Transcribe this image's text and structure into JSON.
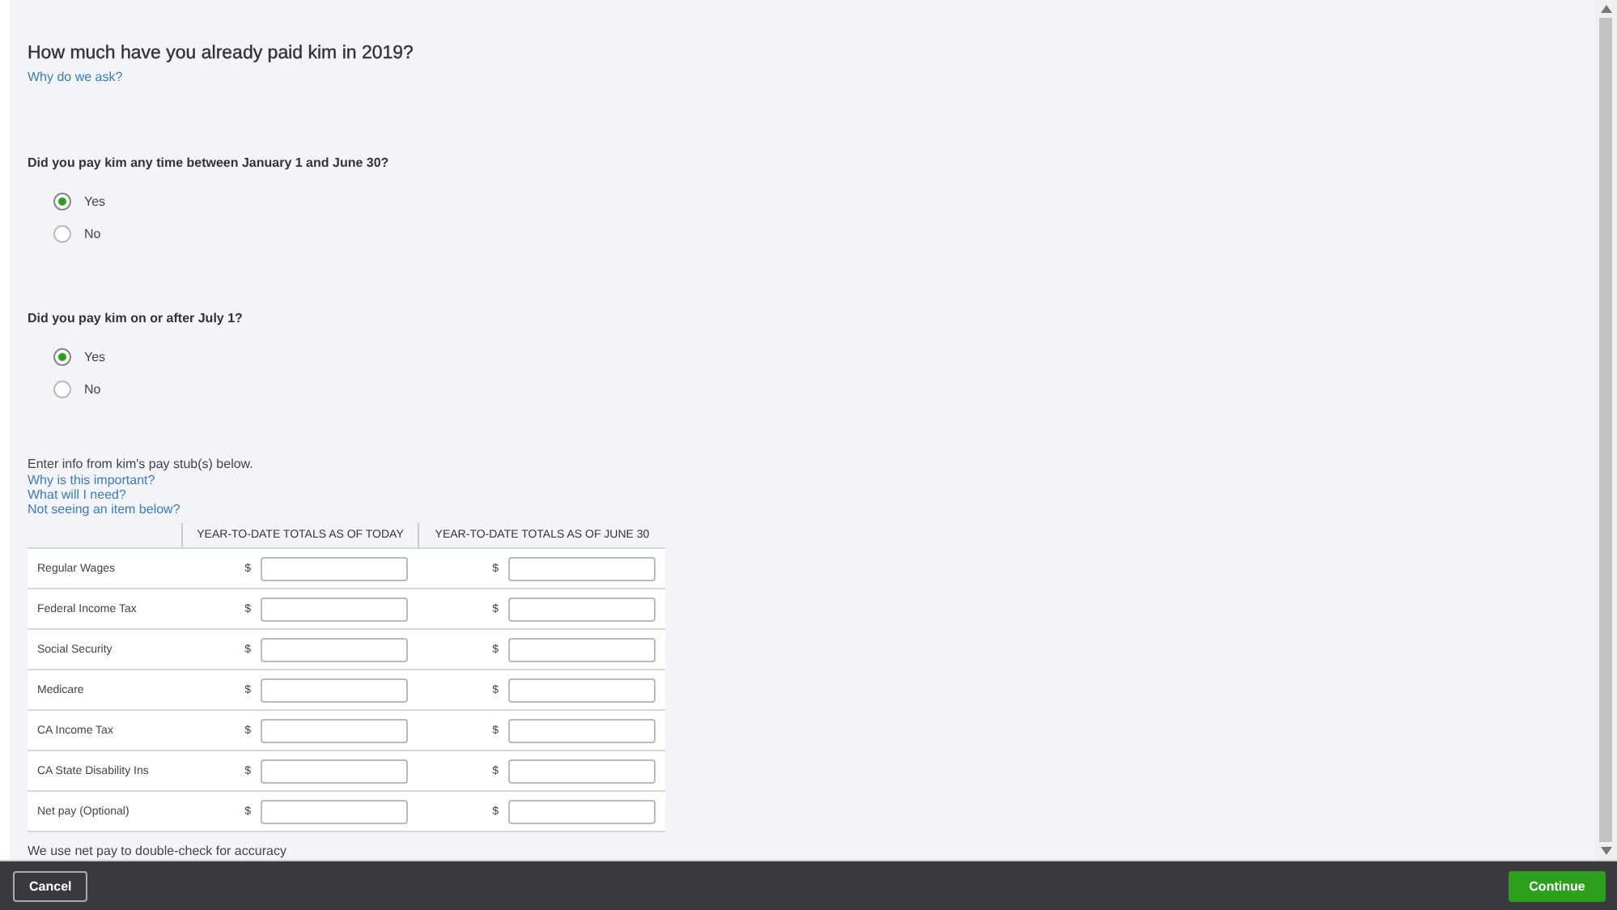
{
  "title": "How much have you already paid kim in 2019?",
  "title_link": "Why do we ask?",
  "questions": [
    {
      "label": "Did you pay kim any time between January 1 and June 30?",
      "options": [
        {
          "label": "Yes",
          "selected": true
        },
        {
          "label": "No",
          "selected": false
        }
      ]
    },
    {
      "label": "Did you pay kim on or after July 1?",
      "options": [
        {
          "label": "Yes",
          "selected": true
        },
        {
          "label": "No",
          "selected": false
        }
      ]
    }
  ],
  "stub_intro": "Enter info from kim's pay stub(s) below.",
  "help_links": [
    "Why is this important?",
    "What will I need?",
    "Not seeing an item below?"
  ],
  "table": {
    "columns": [
      "YEAR-TO-DATE TOTALS AS OF TODAY",
      "YEAR-TO-DATE TOTALS AS OF JUNE 30"
    ],
    "rows": [
      {
        "label": "Regular Wages",
        "cells": [
          "$",
          "$"
        ]
      },
      {
        "label": "Federal Income Tax",
        "cells": [
          "$",
          "$"
        ]
      },
      {
        "label": "Social Security",
        "cells": [
          "$",
          "$"
        ]
      },
      {
        "label": "Medicare",
        "cells": [
          "$",
          "$"
        ]
      },
      {
        "label": "CA Income Tax",
        "cells": [
          "$",
          "$"
        ]
      },
      {
        "label": "CA State Disability Ins",
        "cells": [
          "$",
          "$"
        ]
      },
      {
        "label": "Net pay (Optional)",
        "cells": [
          "$",
          "$"
        ]
      }
    ]
  },
  "note": "We use net pay to double-check for accuracy",
  "footer": {
    "cancel": "Cancel",
    "continue": "Continue"
  }
}
